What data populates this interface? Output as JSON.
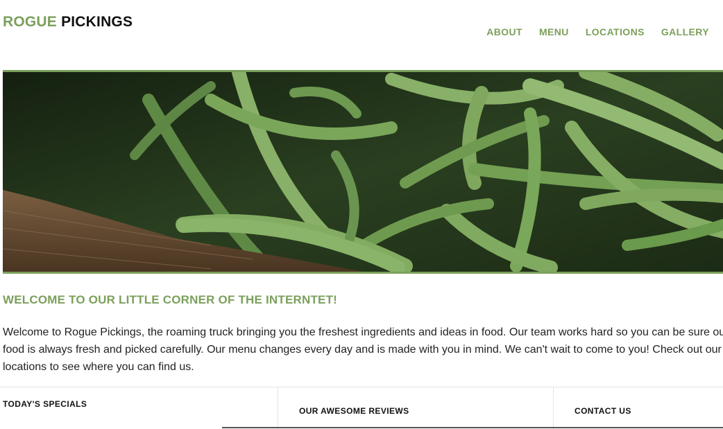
{
  "brand": {
    "accent_text": "ROGUE",
    "dark_text": "PICKINGS"
  },
  "nav": {
    "items": [
      "ABOUT",
      "MENU",
      "LOCATIONS",
      "GALLERY"
    ]
  },
  "hero": {
    "icon": "green-beans-photo"
  },
  "welcome": {
    "title": "WELCOME TO OUR LITTLE CORNER OF THE INTERNTET!",
    "body": "Welcome to Rogue Pickings, the roaming truck bringing you the freshest ingredients and ideas in food. Our team works hard so you can be sure our food is always fresh and picked carefully. Our menu changes every day and is made with you in mind. We can't wait to come to you! Check out our locations to see where you can find us."
  },
  "sections": {
    "specials": "TODAY'S SPECIALS",
    "reviews": "OUR AWESOME REVIEWS",
    "contact": "CONTACT US"
  },
  "colors": {
    "accent": "#7ba05b",
    "text": "#222222"
  }
}
